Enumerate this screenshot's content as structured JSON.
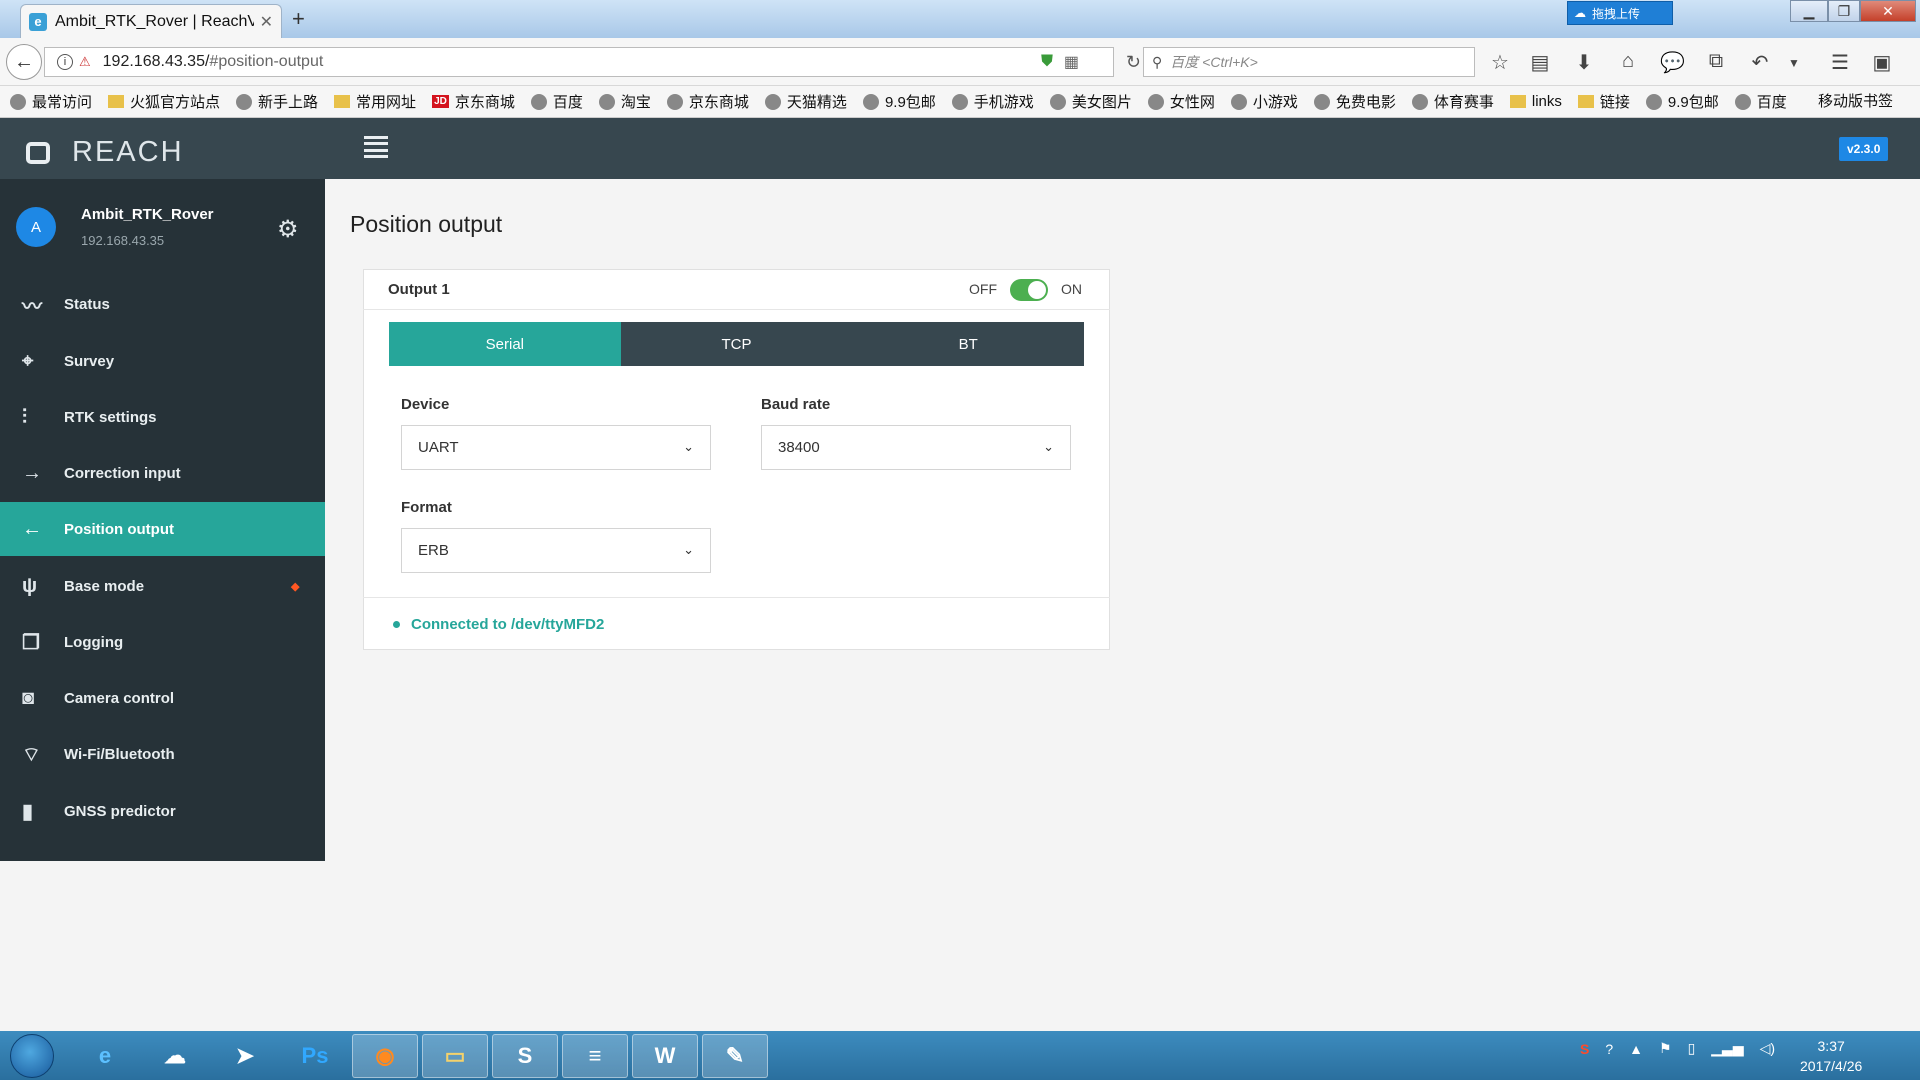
{
  "browser": {
    "tab_title": "Ambit_RTK_Rover | ReachV",
    "url_host": "192.168.43.35/",
    "url_path": "#position-output",
    "search_placeholder": "百度 <Ctrl+K>",
    "cloud_upload_label": "拖拽上传",
    "bookmarks": [
      "最常访问",
      "火狐官方站点",
      "新手上路",
      "常用网址",
      "京东商城",
      "百度",
      "淘宝",
      "京东商城",
      "天猫精选",
      "9.9包邮",
      "手机游戏",
      "美女图片",
      "女性网",
      "小游戏",
      "免费电影",
      "体育赛事",
      "links",
      "链接",
      "9.9包邮",
      "百度"
    ],
    "mobile_bookmarks": "移动版书签"
  },
  "app": {
    "brand": "REACH",
    "version": "v2.3.0",
    "device_initial": "A",
    "device_name": "Ambit_RTK_Rover",
    "device_ip": "192.168.43.35"
  },
  "sidebar": {
    "items": [
      {
        "label": "Status",
        "icon": "pulse-icon"
      },
      {
        "label": "Survey",
        "icon": "location-pin-icon"
      },
      {
        "label": "RTK settings",
        "icon": "sliders-icon"
      },
      {
        "label": "Correction input",
        "icon": "arrow-right-icon"
      },
      {
        "label": "Position output",
        "icon": "arrow-left-icon",
        "active": true
      },
      {
        "label": "Base mode",
        "icon": "antenna-icon"
      },
      {
        "label": "Logging",
        "icon": "copy-icon"
      },
      {
        "label": "Camera control",
        "icon": "camera-icon"
      },
      {
        "label": "Wi-Fi/Bluetooth",
        "icon": "wifi-icon"
      },
      {
        "label": "GNSS predictor",
        "icon": "bar-chart-icon"
      }
    ]
  },
  "main": {
    "title": "Position output",
    "output": {
      "name": "Output 1",
      "off_label": "OFF",
      "on_label": "ON",
      "enabled": true,
      "tabs": [
        "Serial",
        "TCP",
        "BT"
      ],
      "selected_tab": "Serial",
      "device_label": "Device",
      "device_value": "UART",
      "baud_label": "Baud rate",
      "baud_value": "38400",
      "format_label": "Format",
      "format_value": "ERB",
      "status_text": "Connected to /dev/ttyMFD2"
    }
  },
  "taskbar": {
    "time": "3:37",
    "date": "2017/4/26"
  },
  "colors": {
    "header": "#37474f",
    "sidebar": "#263238",
    "accent": "#26a69a",
    "toggle_on": "#4caf50",
    "version_badge": "#1e88e5"
  }
}
